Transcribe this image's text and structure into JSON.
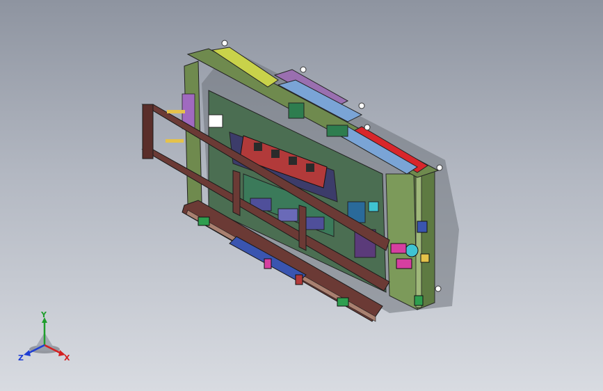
{
  "viewport": {
    "background_top": "#8e94a0",
    "background_bottom": "#d8dbe1",
    "model_view": "isometric-assembly",
    "colors": {
      "frame": "#6f8a4e",
      "red_beam": "#d8262b",
      "blue_beam": "#7aa4d6",
      "purple_beam": "#9a6fb0",
      "yellow_beam": "#c9d24a",
      "dark_rail": "#6b3a35",
      "green_block": "#2e7d4f",
      "magenta": "#d63fa0",
      "cyan": "#3fc4d2"
    }
  },
  "triad": {
    "icon": "coordinate-triad-icon",
    "x_label": "X",
    "y_label": "Y",
    "z_label": "Z",
    "x_color": "#d42020",
    "y_color": "#1f9e2c",
    "z_color": "#1f3ed4"
  }
}
